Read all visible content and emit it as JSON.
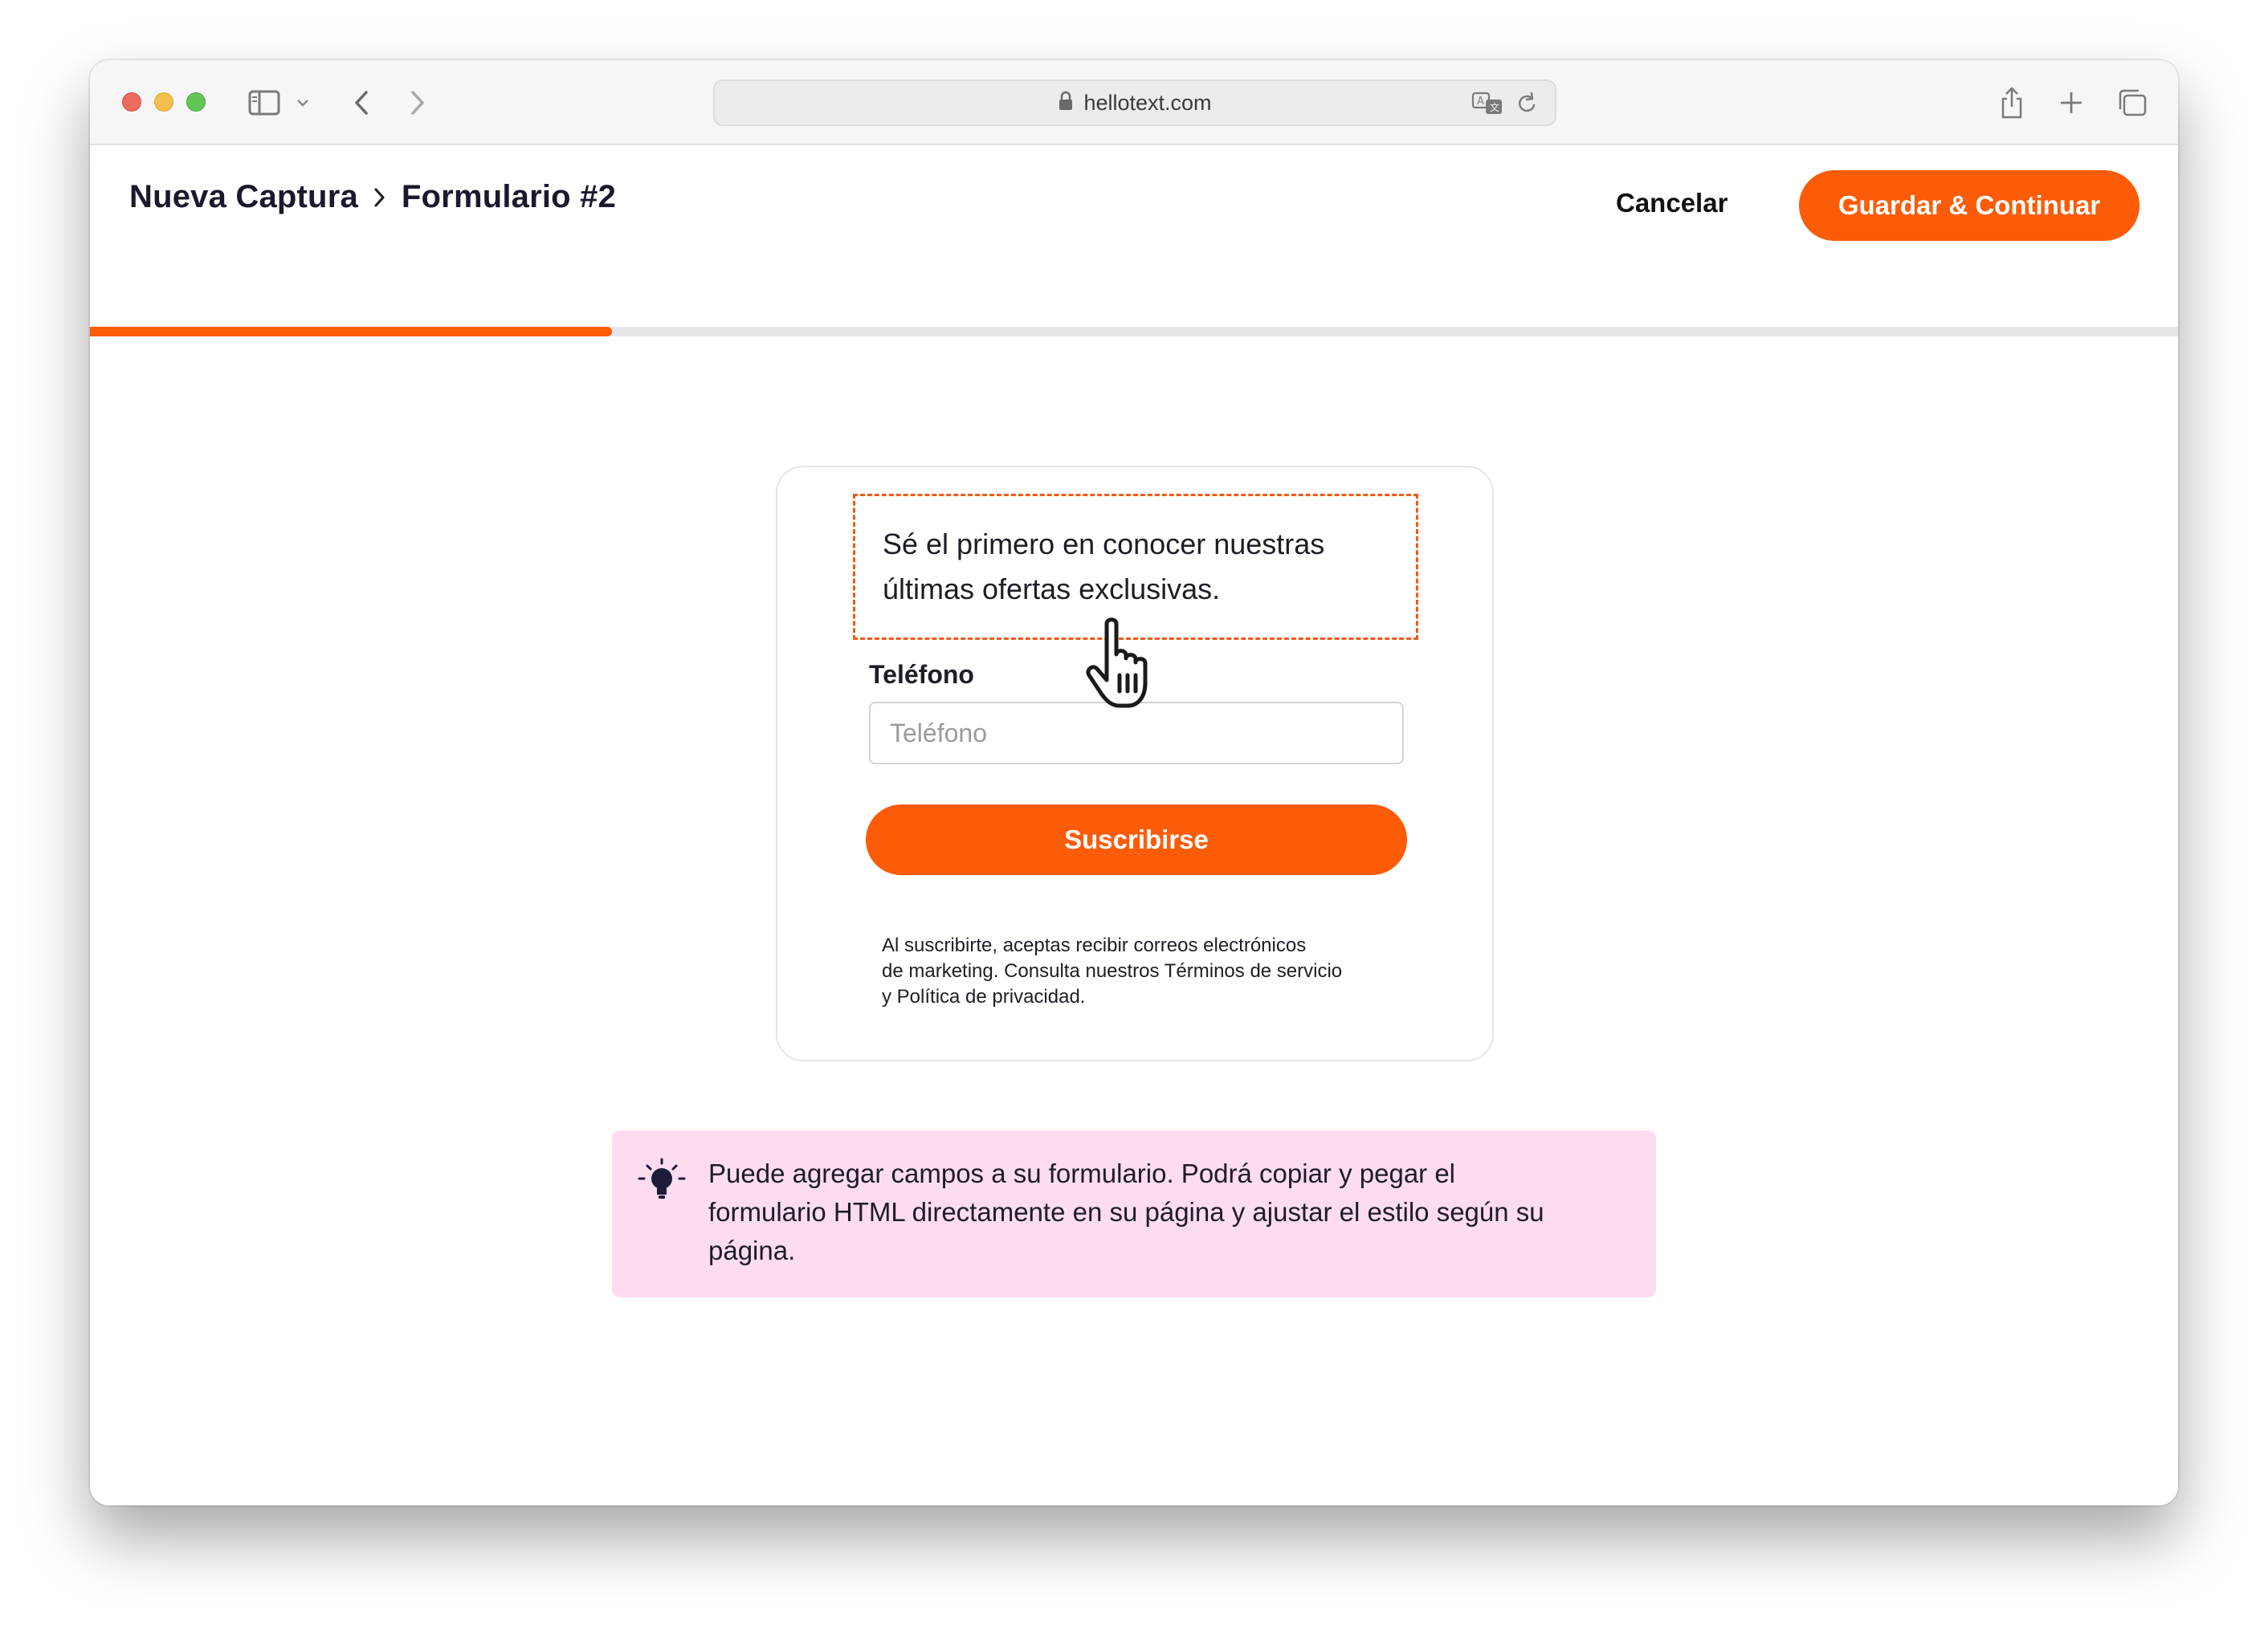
{
  "browser": {
    "url": "hellotext.com"
  },
  "header": {
    "breadcrumb": [
      "Nueva Captura",
      "Formulario #2"
    ],
    "cancel_label": "Cancelar",
    "save_label": "Guardar & Continuar",
    "progress_fraction": 0.25
  },
  "form": {
    "heading_lines": [
      "Sé el primero en conocer nuestras",
      "últimas ofertas exclusivas."
    ],
    "phone_label": "Teléfono",
    "phone_placeholder": "Teléfono",
    "subscribe_label": "Suscribirse",
    "legal_lines": [
      "Al suscribirte, aceptas recibir correos electrónicos",
      "de marketing. Consulta nuestros Términos de servicio",
      "y Política de privacidad."
    ]
  },
  "tip": {
    "icon": "lightbulb-icon",
    "lines": [
      "Puede agregar campos a su formulario. Podrá copiar y pegar el",
      "formulario HTML directamente en su página y ajustar el estilo según su",
      "página."
    ]
  },
  "colors": {
    "accent": "#fc5c08",
    "tip_background": "#fddcf0",
    "dashed_border": "#f05a19"
  }
}
